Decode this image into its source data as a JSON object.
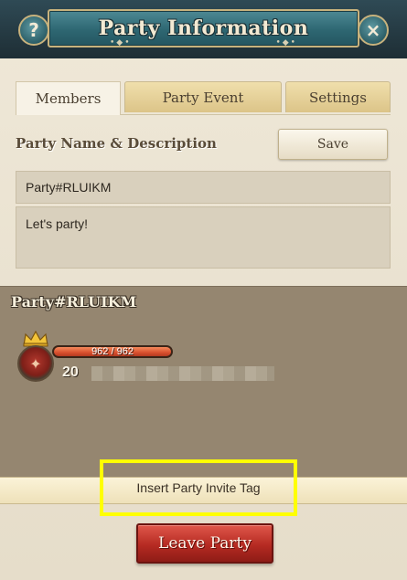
{
  "header": {
    "title": "Party Information",
    "help_label": "?",
    "close_label": "×"
  },
  "tabs": [
    {
      "label": "Members",
      "active": true
    },
    {
      "label": "Party Event",
      "active": false
    },
    {
      "label": "Settings",
      "active": false
    }
  ],
  "party_form": {
    "section_label": "Party Name & Description",
    "save_label": "Save",
    "name_value": "Party#RLUIKM",
    "description_value": "Let's party!"
  },
  "party": {
    "name": "Party#RLUIKM",
    "members": [
      {
        "hp": "962 / 962",
        "hp_fraction": 1.0,
        "level": "20",
        "is_leader": true
      }
    ]
  },
  "actions": {
    "invite_label": "Insert Party Invite Tag",
    "leave_label": "Leave Party"
  },
  "colors": {
    "highlight": "#ffff00",
    "leave_button": "#b52a22",
    "header_teal": "#2e6772"
  }
}
